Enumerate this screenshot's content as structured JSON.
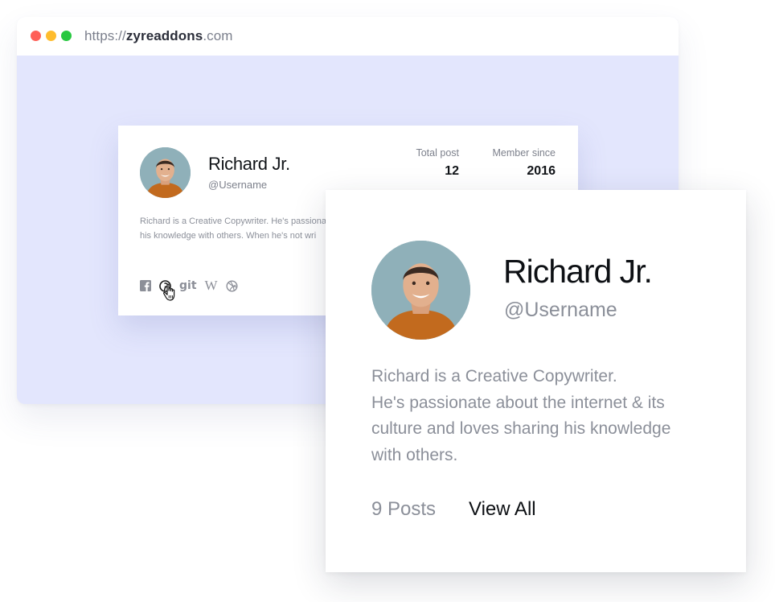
{
  "browser": {
    "url_prefix": "https://",
    "url_domain": "zyreaddons",
    "url_suffix": ".com",
    "dot_colors": [
      "#fe5f57",
      "#febc2e",
      "#28c840"
    ]
  },
  "card_small": {
    "name": "Richard Jr.",
    "username": "@Username",
    "stats": [
      {
        "label": "Total post",
        "value": "12"
      },
      {
        "label": "Member since",
        "value": "2016"
      }
    ],
    "bio_line1": "Richard is a Creative Copywriter. He's passionate",
    "bio_line2": "his knowledge with others. When he's not wri",
    "social_icons": [
      "facebook-icon",
      "pinterest-icon",
      "git-icon",
      "wikipedia-icon",
      "dribbble-icon"
    ],
    "git_label": "git",
    "wiki_label": "W"
  },
  "card_large": {
    "name": "Richard Jr.",
    "username": "@Username",
    "bio_lines": [
      "Richard is a Creative Copywriter.",
      "He's passionate about the internet & its",
      "culture and loves sharing his knowledge",
      "with others."
    ],
    "posts_label": "9 Posts",
    "view_all_label": "View All"
  },
  "colors": {
    "browser_bg": "#e3e6fd",
    "text_dark": "#111418",
    "text_muted": "#8b8f99"
  }
}
